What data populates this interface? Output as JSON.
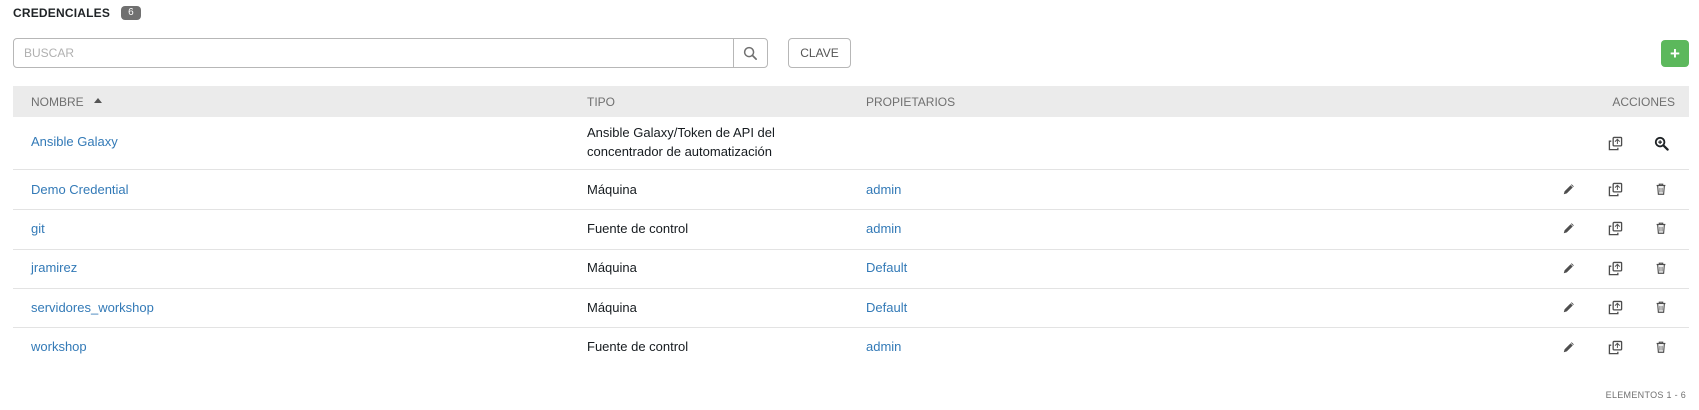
{
  "header": {
    "title": "CREDENCIALES",
    "count": "6"
  },
  "search": {
    "placeholder": "BUSCAR",
    "icon": "search-icon"
  },
  "toolbar": {
    "key_button": "CLAVE",
    "add_button": "+",
    "add_color": "#5cb85c"
  },
  "table": {
    "columns": [
      "NOMBRE",
      "TIPO",
      "PROPIETARIOS",
      "ACCIONES"
    ],
    "sort_column": "NOMBRE",
    "rows": [
      {
        "name": "Ansible Galaxy",
        "type_line1": "Ansible Galaxy/Token de API del",
        "type_line2": "concentrador de automatización",
        "owner": "",
        "actions": [
          "copy-icon",
          "view-icon"
        ]
      },
      {
        "name": "Demo Credential",
        "type": "Máquina",
        "owner": "admin",
        "actions": [
          "edit-icon",
          "copy-icon",
          "delete-icon"
        ]
      },
      {
        "name": "git",
        "type": "Fuente de control",
        "owner": "admin",
        "actions": [
          "edit-icon",
          "copy-icon",
          "delete-icon"
        ]
      },
      {
        "name": "jramirez",
        "type": "Máquina",
        "owner": "Default",
        "actions": [
          "edit-icon",
          "copy-icon",
          "delete-icon"
        ]
      },
      {
        "name": "servidores_workshop",
        "type": "Máquina",
        "owner": "Default",
        "actions": [
          "edit-icon",
          "copy-icon",
          "delete-icon"
        ]
      },
      {
        "name": "workshop",
        "type": "Fuente de control",
        "owner": "admin",
        "actions": [
          "edit-icon",
          "copy-icon",
          "delete-icon"
        ]
      }
    ]
  },
  "footer": {
    "items": "ELEMENTOS  1 - 6"
  }
}
